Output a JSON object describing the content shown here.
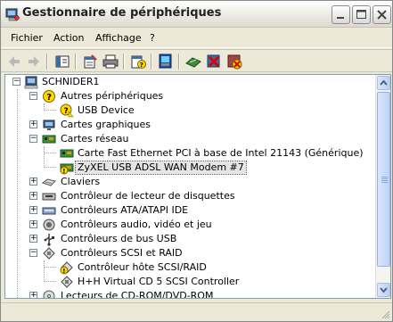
{
  "window": {
    "title": "Gestionnaire de périphériques"
  },
  "menu": {
    "fichier": "Fichier",
    "action": "Action",
    "affichage": "Affichage",
    "help": "?"
  },
  "toolbar": {
    "icons": [
      "back-arrow-icon",
      "forward-arrow-icon",
      "console-tree-icon",
      "properties-icon",
      "print-icon",
      "help-icon",
      "scan-hardware-icon",
      "update-driver-icon",
      "disable-device-icon",
      "uninstall-device-icon"
    ]
  },
  "tree": {
    "root": "SCHNIDER1",
    "items": [
      {
        "label": "Autres périphériques",
        "expanded": true
      },
      {
        "label": "USB Device"
      },
      {
        "label": "Cartes graphiques",
        "expanded": false
      },
      {
        "label": "Cartes réseau",
        "expanded": true
      },
      {
        "label": "Carte Fast Ethernet PCI à base de Intel 21143 (Générique)"
      },
      {
        "label": "ZyXEL USB ADSL WAN Modem #7",
        "selected": true
      },
      {
        "label": "Claviers",
        "expanded": false
      },
      {
        "label": "Contrôleur de lecteur de disquettes",
        "expanded": false
      },
      {
        "label": "Contrôleurs ATA/ATAPI IDE",
        "expanded": false
      },
      {
        "label": "Contrôleurs audio, vidéo et jeu",
        "expanded": false
      },
      {
        "label": "Contrôleurs de bus USB",
        "expanded": false
      },
      {
        "label": "Contrôleurs SCSI et RAID",
        "expanded": true
      },
      {
        "label": "Contrôleur hôte SCSI/RAID"
      },
      {
        "label": "H+H Virtual CD 5 SCSI Controller"
      },
      {
        "label": "Lecteurs de CD-ROM/DVD-ROM",
        "expanded": false
      }
    ]
  },
  "colors": {
    "selection": "#e5e5e5",
    "tree_border": "#7f9db9",
    "window_bg": "#ece9d8"
  }
}
